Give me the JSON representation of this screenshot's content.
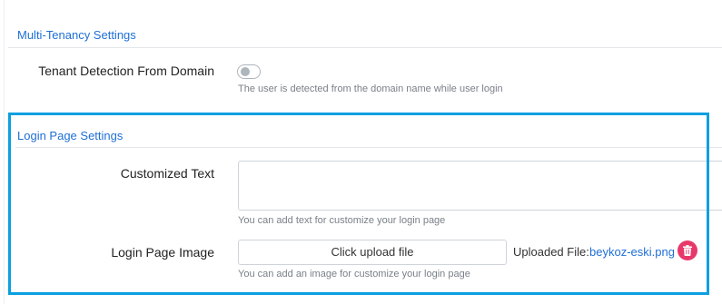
{
  "multi_tenancy": {
    "title": "Multi-Tenancy Settings",
    "tenant_detection": {
      "label": "Tenant Detection From Domain",
      "help": "The user is detected from the domain name while user login",
      "enabled": false
    }
  },
  "login_page": {
    "title": "Login Page Settings",
    "customized_text": {
      "label": "Customized Text",
      "value": "",
      "help": "You can add text for customize your login page"
    },
    "image": {
      "label": "Login Page Image",
      "upload_label": "Click upload file",
      "uploaded_label": "Uploaded File:",
      "file_name": "beykoz-eski.png",
      "help": "You can add an image for customize your login page"
    }
  },
  "colors": {
    "accent": "#1f6fd6",
    "highlight": "#0b9fe0",
    "delete": "#e8386b"
  },
  "icons": [
    "trash-icon"
  ]
}
